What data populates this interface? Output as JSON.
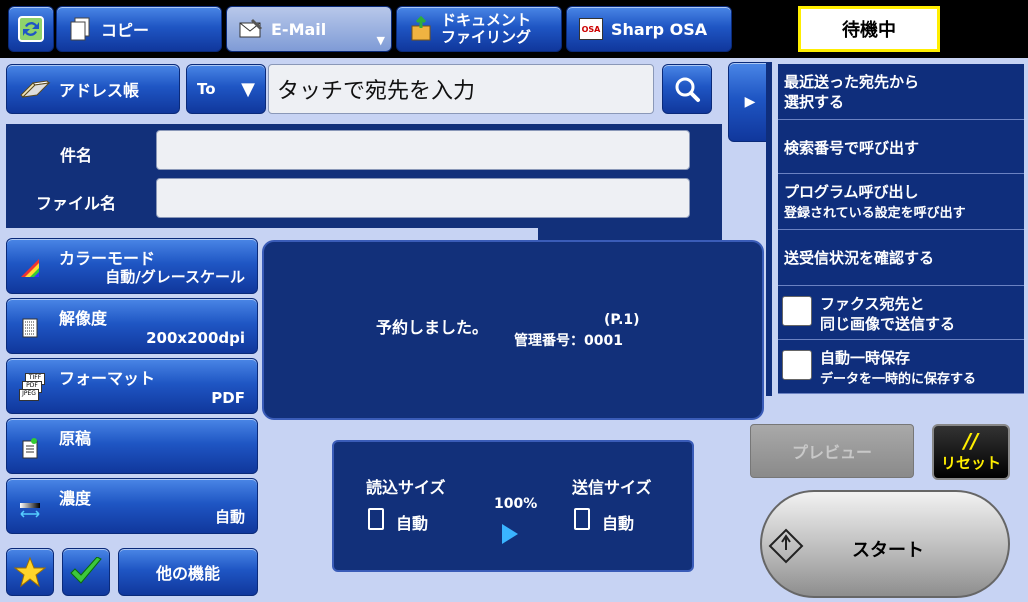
{
  "tabs": {
    "copy": "コピー",
    "email": "E-Mail",
    "doc_filing_line1": "ドキュメント",
    "doc_filing_line2": "ファイリング",
    "sharp_osa": "Sharp OSA",
    "osa_icon_text": "OSA"
  },
  "status": "待機中",
  "address": {
    "book_label": "アドレス帳",
    "to_label": "To",
    "placeholder": "タッチで宛先を入力"
  },
  "fields": {
    "subject_label": "件名",
    "subject_value": "",
    "filename_label": "ファイル名",
    "filename_value": ""
  },
  "settings": [
    {
      "title": "カラーモード",
      "value": "自動/グレースケール"
    },
    {
      "title": "解像度",
      "value": "200x200dpi"
    },
    {
      "title": "フォーマット",
      "value": "PDF"
    },
    {
      "title": "原稿",
      "value": ""
    },
    {
      "title": "濃度",
      "value": "自動"
    }
  ],
  "format_icon_text": [
    "TIFF",
    "PDF",
    "JPEG"
  ],
  "bottom_left": {
    "other_functions": "他の機能"
  },
  "message": {
    "reserved": "予約しました。",
    "page": "(P.1)",
    "mgmt": "管理番号：0001"
  },
  "size_panel": {
    "scan_label": "読込サイズ",
    "scan_value": "自動",
    "send_label": "送信サイズ",
    "send_value": "自動",
    "ratio": "100%"
  },
  "right_panel": [
    {
      "line1": "最近送った宛先から",
      "line2": "選択する"
    },
    {
      "line1": "検索番号で呼び出す",
      "line2": ""
    },
    {
      "line1": "プログラム呼び出し",
      "line2": "登録されている設定を呼び出す"
    },
    {
      "line1": "送受信状況を確認する",
      "line2": ""
    }
  ],
  "checkboxes": [
    {
      "line1": "ファクス宛先と",
      "line2": "同じ画像で送信する",
      "checked": false
    },
    {
      "line1": "自動一時保存",
      "line2": "データを一時的に保存する",
      "checked": false
    }
  ],
  "actions": {
    "preview": "プレビュー",
    "reset_mark": "//",
    "reset": "リセット",
    "start": "スタート"
  },
  "colors": {
    "accent": "#1f56c4",
    "status_border": "#ffee00",
    "reset_text": "#ffee00"
  }
}
